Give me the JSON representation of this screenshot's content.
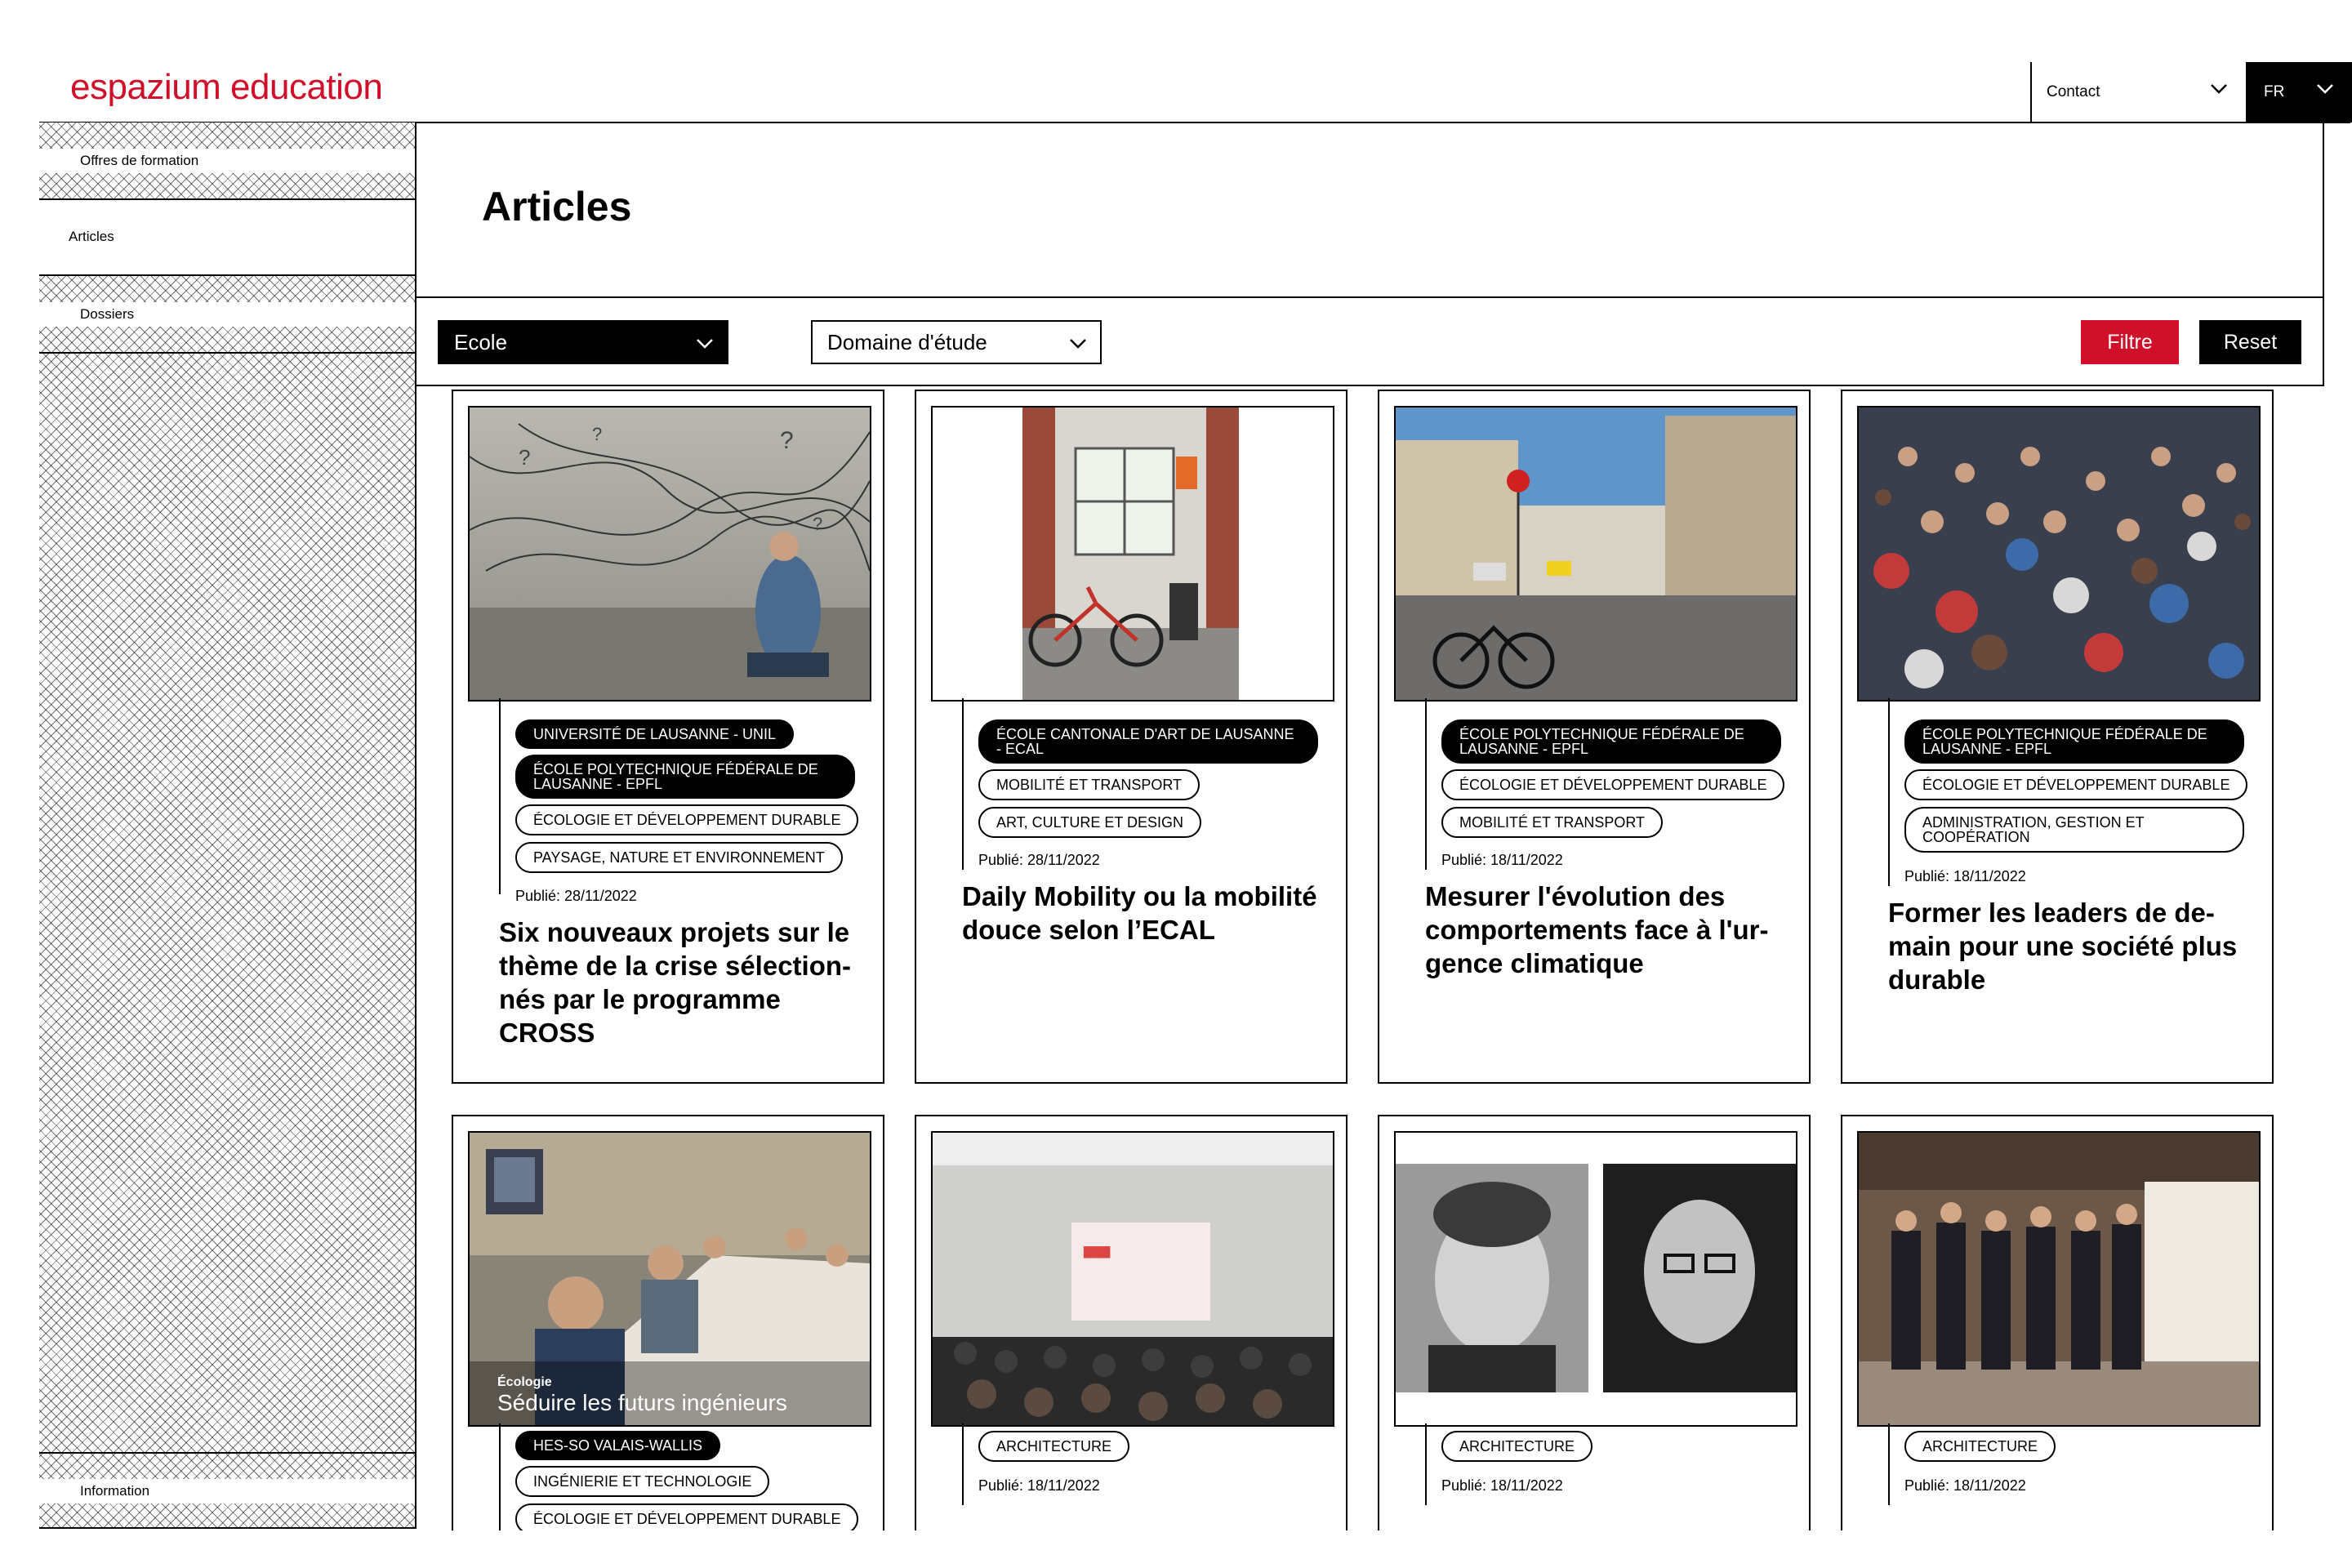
{
  "brand": {
    "logo": "espazium education",
    "accent": "#d0102a"
  },
  "topbar": {
    "contact": "Contact",
    "language": "FR"
  },
  "sidebar": {
    "items": [
      {
        "label": "Offres de formation"
      },
      {
        "label": "Articles"
      },
      {
        "label": "Dossiers"
      }
    ],
    "footer": "Information"
  },
  "page": {
    "title": "Articles"
  },
  "filters": {
    "school": "Ecole",
    "domain": "Domaine d'étude",
    "filter_btn": "Filtre",
    "reset_btn": "Reset"
  },
  "icons": {
    "chevron": "chevron-down-icon"
  },
  "articles": [
    {
      "tags": [
        "UNIVERSITÉ DE LAUSANNE - UNIL",
        "ÉCOLE POLYTECHNIQUE FÉDÉRALE DE LAUSANNE - EPFL",
        "ÉCOLOGIE ET DÉVELOPPEMENT DURABLE",
        "PAYSAGE, NATURE ET ENVIRONNEMENT"
      ],
      "published": "Publié: 28/11/2022",
      "title": "Six nouveaux projets sur le thème de la crise sélection-nés par le programme CROSS"
    },
    {
      "tags": [
        "ÉCOLE CANTONALE D'ART DE LAUSANNE - ECAL",
        "MOBILITÉ ET TRANSPORT",
        "ART, CULTURE ET DESIGN"
      ],
      "published": "Publié: 28/11/2022",
      "title": "Daily Mobility ou la mobilité douce selon l’ECAL"
    },
    {
      "tags": [
        "ÉCOLE POLYTECHNIQUE FÉDÉRALE DE LAUSANNE - EPFL",
        "ÉCOLOGIE ET DÉVELOPPEMENT DURABLE",
        "MOBILITÉ ET TRANSPORT"
      ],
      "published": "Publié: 18/11/2022",
      "title": "Mesurer l'évolution des comportements face à l'ur-gence climatique"
    },
    {
      "tags": [
        "ÉCOLE POLYTECHNIQUE FÉDÉRALE DE LAUSANNE - EPFL",
        "ÉCOLOGIE ET DÉVELOPPEMENT DURABLE",
        "ADMINISTRATION, GESTION ET COOPÉRATION"
      ],
      "published": "Publié: 18/11/2022",
      "title": "Former les leaders de de-main pour une société plus durable"
    },
    {
      "image_caption_small": "Écologie",
      "image_caption": "Séduire les futurs ingénieurs",
      "tags": [
        "HES-SO VALAIS-WALLIS",
        "INGÉNIERIE ET TECHNOLOGIE",
        "ÉCOLOGIE ET DÉVELOPPEMENT DURABLE"
      ]
    },
    {
      "tags": [
        "ARCHITECTURE"
      ],
      "published": "Publié: 18/11/2022"
    },
    {
      "tags": [
        "ARCHITECTURE"
      ],
      "published": "Publié: 18/11/2022"
    },
    {
      "tags": [
        "ARCHITECTURE"
      ],
      "published": "Publié: 18/11/2022"
    }
  ]
}
